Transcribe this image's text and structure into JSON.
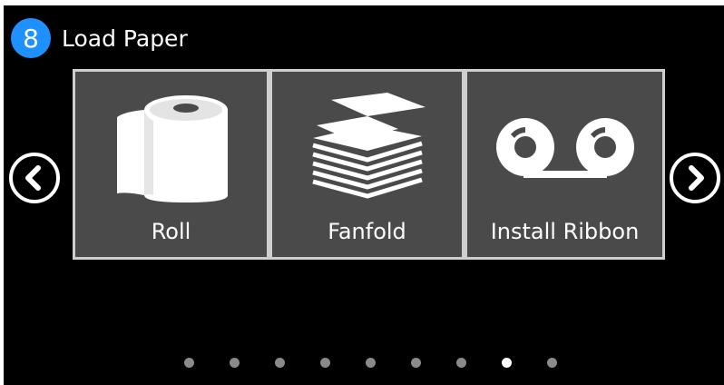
{
  "header": {
    "step_number": "8",
    "title": "Load Paper"
  },
  "tiles": [
    {
      "label": "Roll",
      "icon": "paper-roll-icon"
    },
    {
      "label": "Fanfold",
      "icon": "fanfold-stack-icon"
    },
    {
      "label": "Install Ribbon",
      "icon": "ribbon-cassette-icon"
    }
  ],
  "navigation": {
    "prev_icon": "chevron-left-icon",
    "next_icon": "chevron-right-icon"
  },
  "pagination": {
    "total_pages": 9,
    "active_page": 8
  },
  "colors": {
    "background": "#000000",
    "badge": "#1e90ff",
    "tile": "#4a4a4a",
    "tile_border": "#cfcfcf",
    "dot_inactive": "#8a8a8a",
    "dot_active": "#ffffff"
  }
}
